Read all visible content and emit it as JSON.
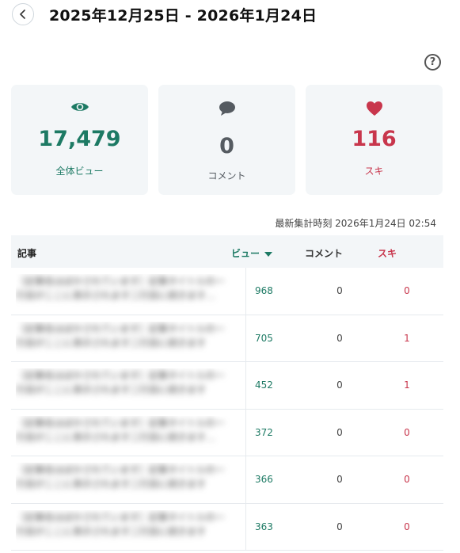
{
  "header": {
    "date_range": "2025年12月25日 - 2026年1月24日",
    "back_icon": "chevron-left-icon",
    "help_icon": "question-circle-icon",
    "help_glyph": "?"
  },
  "stats": {
    "views": {
      "value": "17,479",
      "label": "全体ビュー",
      "icon": "eye-icon",
      "color": "#1d7a64"
    },
    "comments": {
      "value": "0",
      "label": "コメント",
      "icon": "speech-bubble-icon",
      "color": "#555b61"
    },
    "likes": {
      "value": "116",
      "label": "スキ",
      "icon": "heart-icon",
      "color": "#c8364c"
    }
  },
  "last_updated": "最新集計時刻 2026年1月24日 02:54",
  "table": {
    "headers": {
      "article": "記事",
      "views": "ビュー",
      "comments": "コメント",
      "likes": "スキ"
    },
    "sort": {
      "column": "views",
      "direction": "descending"
    },
    "rows": [
      {
        "title": "［記事名はぼかされています］記事タイトルの一行目がここに表示されます二行目に続きます…",
        "views": "968",
        "comments": "0",
        "likes": "0"
      },
      {
        "title": "［記事名はぼかされています］記事タイトルの一行目がここに表示されます二行目に続きます",
        "views": "705",
        "comments": "0",
        "likes": "1"
      },
      {
        "title": "［記事名はぼかされています］記事タイトルの一行目がここに表示されます二行目に続きます",
        "views": "452",
        "comments": "0",
        "likes": "1"
      },
      {
        "title": "［記事名はぼかされています］記事タイトルの一行目がここに表示されます二行目に続きます…",
        "views": "372",
        "comments": "0",
        "likes": "0"
      },
      {
        "title": "［記事名はぼかされています］記事タイトルの一行目がここに表示されます二行目に続きます",
        "views": "366",
        "comments": "0",
        "likes": "0"
      },
      {
        "title": "［記事名はぼかされています］記事タイトルの一行目がここに表示されます二行目に続きます",
        "views": "363",
        "comments": "0",
        "likes": "0"
      }
    ]
  }
}
